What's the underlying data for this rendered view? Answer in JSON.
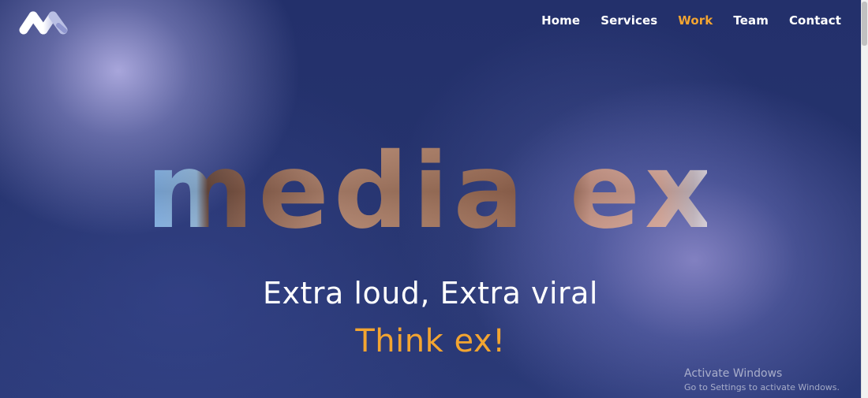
{
  "nav": {
    "items": [
      {
        "label": "Home",
        "active": false
      },
      {
        "label": "Services",
        "active": false
      },
      {
        "label": "Work",
        "active": true
      },
      {
        "label": "Team",
        "active": false
      },
      {
        "label": "Contact",
        "active": false
      }
    ]
  },
  "hero": {
    "brand_text": "media ex",
    "tagline": "Extra loud, Extra viral",
    "cta_text": "Think ex!"
  },
  "watermark": {
    "title": "Activate Windows",
    "subtitle": "Go to Settings to activate Windows."
  },
  "colors": {
    "background": "#23306b",
    "accent": "#f3a531",
    "text": "#ffffff",
    "brand_fill_left": "#7fb0e8",
    "brand_fill_wood": "#a87a62",
    "brand_fill_light": "#d8a89a"
  },
  "icons": {
    "logo": "media-ex-logo-icon"
  }
}
